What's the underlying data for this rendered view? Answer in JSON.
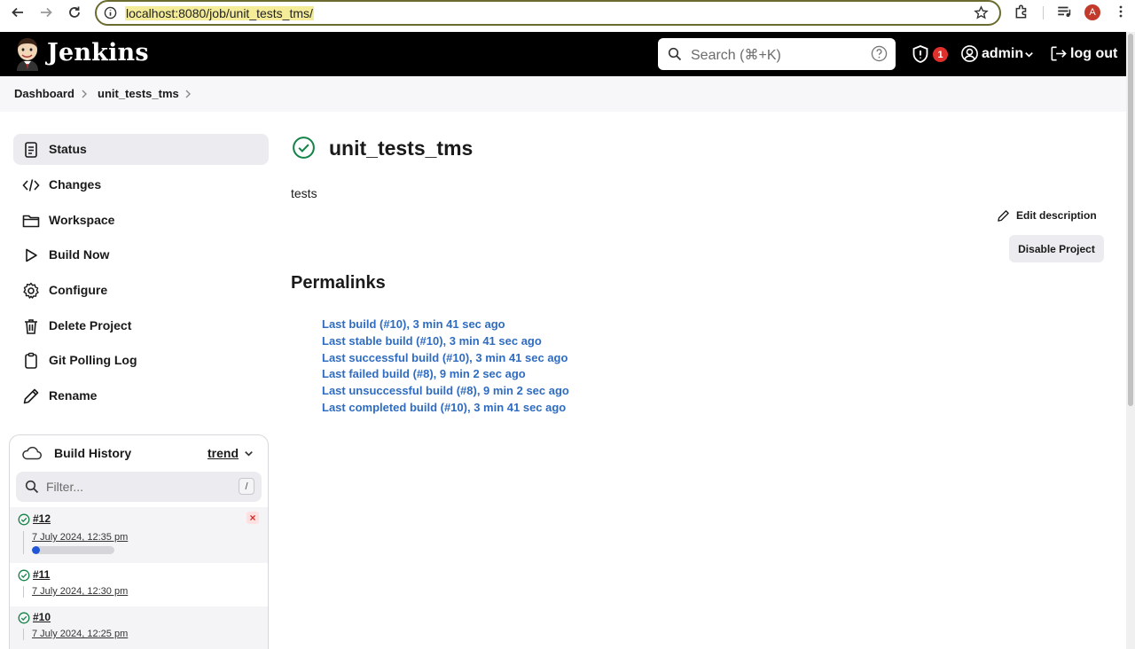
{
  "browser": {
    "url": "localhost:8080/job/unit_tests_tms/",
    "profile_initial": "A"
  },
  "header": {
    "brand": "Jenkins",
    "search_placeholder": "Search (⌘+K)",
    "security_count": "1",
    "user": "admin",
    "logout": "log out"
  },
  "breadcrumb": {
    "items": [
      "Dashboard",
      "unit_tests_tms"
    ]
  },
  "sidebar": {
    "items": [
      {
        "label": "Status",
        "icon": "status-doc-icon",
        "active": true
      },
      {
        "label": "Changes",
        "icon": "code-icon"
      },
      {
        "label": "Workspace",
        "icon": "folder-icon"
      },
      {
        "label": "Build Now",
        "icon": "play-icon"
      },
      {
        "label": "Configure",
        "icon": "gear-icon"
      },
      {
        "label": "Delete Project",
        "icon": "trash-icon"
      },
      {
        "label": "Git Polling Log",
        "icon": "clipboard-icon"
      },
      {
        "label": "Rename",
        "icon": "pencil-icon"
      }
    ]
  },
  "build_history": {
    "title": "Build History",
    "trend": "trend",
    "filter_placeholder": "Filter...",
    "filter_shortcut": "/",
    "builds": [
      {
        "number": "#12",
        "date": "7 July 2024, 12:35 pm",
        "in_progress": true,
        "progress": 0.1
      },
      {
        "number": "#11",
        "date": "7 July 2024, 12:30 pm"
      },
      {
        "number": "#10",
        "date": "7 July 2024, 12:25 pm"
      }
    ]
  },
  "main": {
    "title": "unit_tests_tms",
    "description": "tests",
    "edit_description": "Edit description",
    "disable_project": "Disable Project",
    "permalinks_heading": "Permalinks",
    "permalinks": [
      "Last build (#10), 3 min 41 sec ago",
      "Last stable build (#10), 3 min 41 sec ago",
      "Last successful build (#10), 3 min 41 sec ago",
      "Last failed build (#8), 9 min 2 sec ago",
      "Last unsuccessful build (#8), 9 min 2 sec ago",
      "Last completed build (#10), 3 min 41 sec ago"
    ]
  },
  "colors": {
    "header_bg": "#000000",
    "link": "#2f6cc0",
    "success": "#138347",
    "badge": "#e0302c"
  }
}
